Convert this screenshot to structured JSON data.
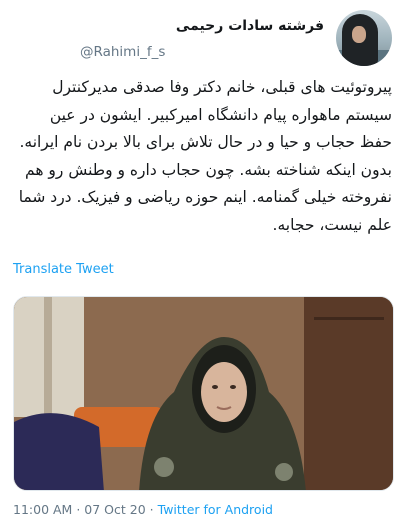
{
  "tweet": {
    "author": {
      "display_name": "فرشته سادات رحیمی",
      "username": "@Rahimi_f_s"
    },
    "text": "پیروتوئیت های قبلی، خانم دکتر وفا صدقی مدیرکنترل سیستم ماهواره پیام دانشگاه امیرکبیر. ایشون در عین حفظ حجاب و حیا و در حال تلاش برای بالا بردن نام ایرانه. بدون اینکه شناخته بشه. چون حجاب داره و وطنش رو هم نفروخته خیلی گمنامه. اینم حوزه ریاضی و فیزیک. درد شما علم نیست، حجابه.",
    "translate_label": "Translate Tweet",
    "time": "11:00 AM",
    "date": "07 Oct 20",
    "separator": "·",
    "source": "Twitter for Android"
  }
}
